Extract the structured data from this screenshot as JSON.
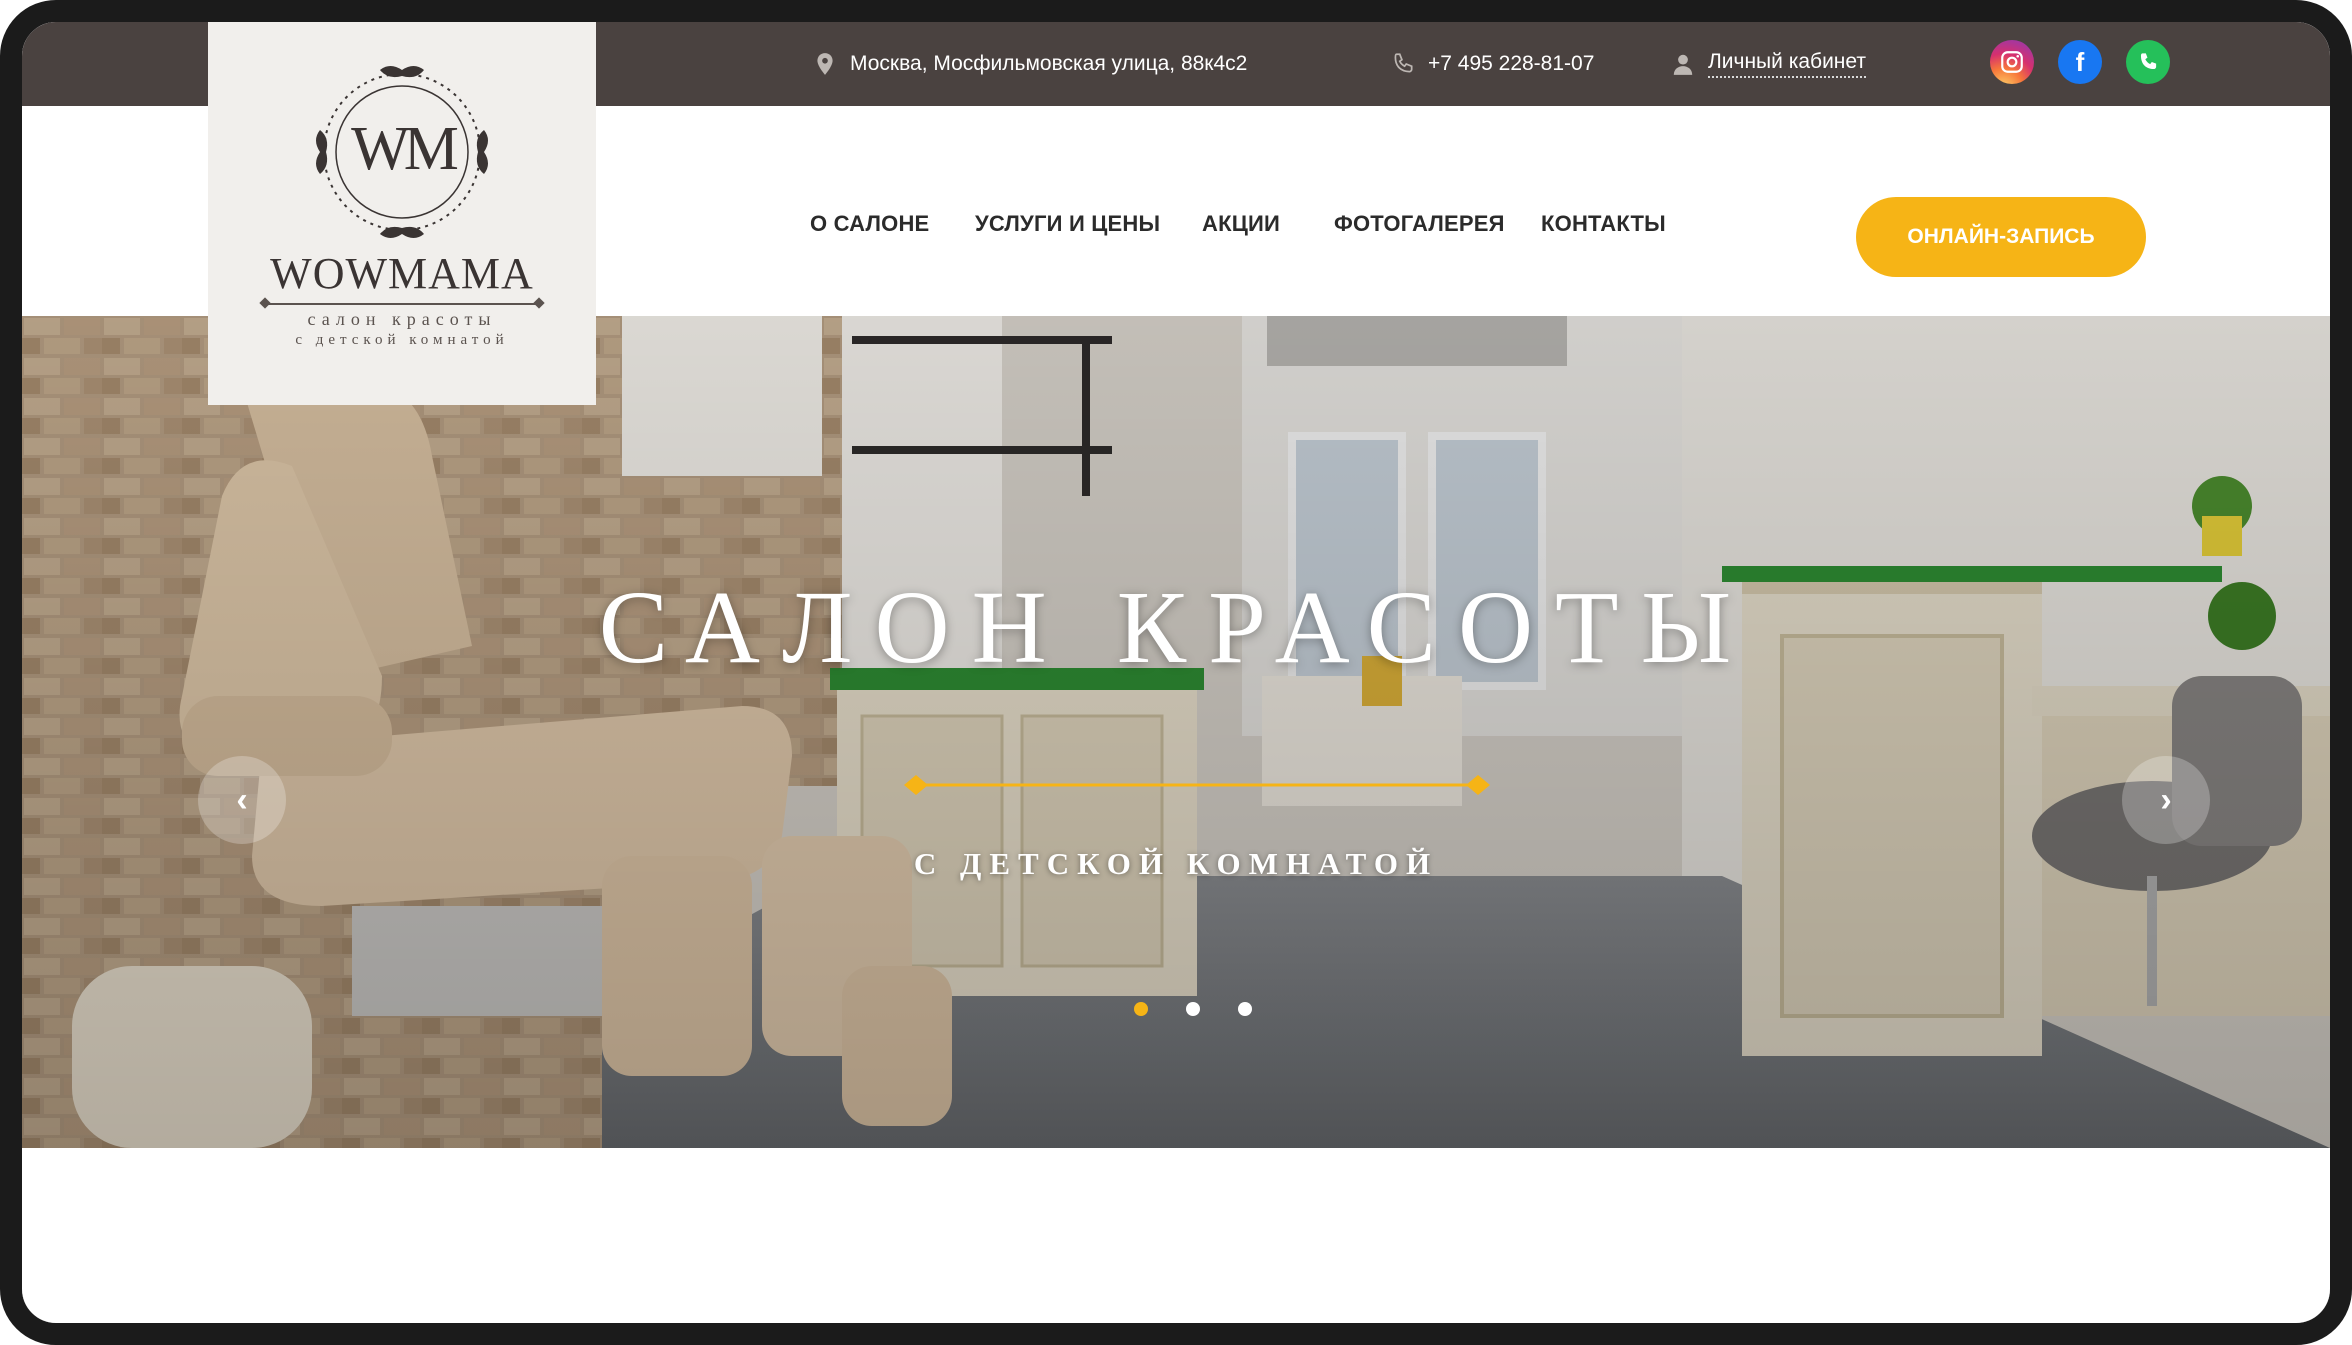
{
  "topbar": {
    "address": "Москва, Мосфильмовская улица, 88к4с2",
    "phone": "+7 495 228-81-07",
    "cabinet_label": "Личный кабинет",
    "social": [
      {
        "name": "instagram-icon",
        "color": "#d6306e"
      },
      {
        "name": "facebook-icon",
        "color": "#1877f2",
        "glyph": "f"
      },
      {
        "name": "whatsapp-icon",
        "color": "#25c05a"
      }
    ]
  },
  "logo": {
    "monogram": "WM",
    "brand": "WOWMAMA",
    "line1": "салон красоты",
    "line2": "с детской комнатой"
  },
  "nav": {
    "items": [
      {
        "label": "О САЛОНЕ"
      },
      {
        "label": "УСЛУГИ И ЦЕНЫ"
      },
      {
        "label": "АКЦИИ"
      },
      {
        "label": "ФОТОГАЛЕРЕЯ"
      },
      {
        "label": "КОНТАКТЫ"
      }
    ],
    "cta_label": "ОНЛАЙН-ЗАПИСЬ"
  },
  "hero": {
    "title": "САЛОН КРАСОТЫ",
    "subtitle": "С ДЕТСКОЙ КОМНАТОЙ",
    "prev_glyph": "‹",
    "next_glyph": "›",
    "slides_total": 3,
    "active_slide": 1
  },
  "colors": {
    "topbar_bg": "#4a4240",
    "accent": "#f6b416",
    "logo_bg": "#f1efec"
  }
}
